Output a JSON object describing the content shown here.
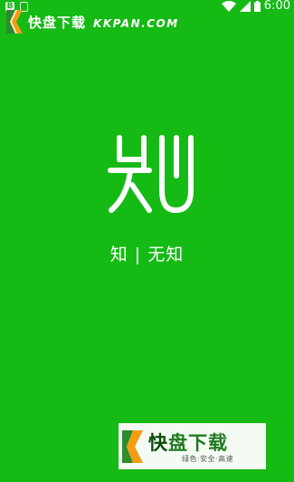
{
  "status_bar": {
    "left_icon_letter": "B",
    "time": "6:00"
  },
  "watermark_top": {
    "brand": "快盘下载",
    "domain": "KKPAN.COM"
  },
  "splash": {
    "logo_icon": "zhi-logo-icon",
    "slogan": "知 | 无知"
  },
  "watermark_bottom": {
    "brand_accent": "快",
    "brand_rest": "盘下载",
    "subtitle": "绿色·安全·高速"
  },
  "colors": {
    "background": "#15ba15",
    "text": "#ffffff"
  }
}
